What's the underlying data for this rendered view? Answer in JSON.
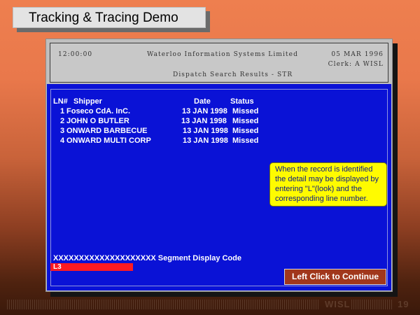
{
  "slide_title": "Tracking & Tracing Demo",
  "terminal": {
    "time": "12:00:00",
    "company": "Waterloo Information Systems Limited",
    "date": "05 MAR 1996",
    "clerk": "Clerk: A WISL",
    "screen_title": "Dispatch Search Results - STR"
  },
  "results": {
    "headers": {
      "ln": "LN#",
      "shipper": "Shipper",
      "date": "Date",
      "status": "Status"
    },
    "rows": [
      {
        "ln": "1",
        "shipper": "Foseco CdA. InC.",
        "date": "13 JAN 1998",
        "status": "Missed"
      },
      {
        "ln": "2",
        "shipper": "JOHN O BUTLER",
        "date": "13 JAN 1998",
        "status": "Missed"
      },
      {
        "ln": "3",
        "shipper": "ONWARD BARBECUE",
        "date": "13 JAN 1998",
        "status": "Missed"
      },
      {
        "ln": "4",
        "shipper": "ONWARD MULTI CORP",
        "date": "13 JAN 1998",
        "status": "Missed"
      }
    ]
  },
  "callout_text": "When the record is identified the detail may be displayed by entering \"L\"(look) and the corresponding line number.",
  "segment_line": "XXXXXXXXXXXXXXXXXXXX Segment Display Code",
  "command_value": "L3",
  "continue_label": "Left Click to Continue",
  "footer": {
    "brand": "WISL",
    "page": "19"
  },
  "colors": {
    "screen_blue": "#0a12d6",
    "callout_yellow": "#fffb00",
    "command_red": "#ff1a22",
    "button_brown": "#a1371c"
  }
}
